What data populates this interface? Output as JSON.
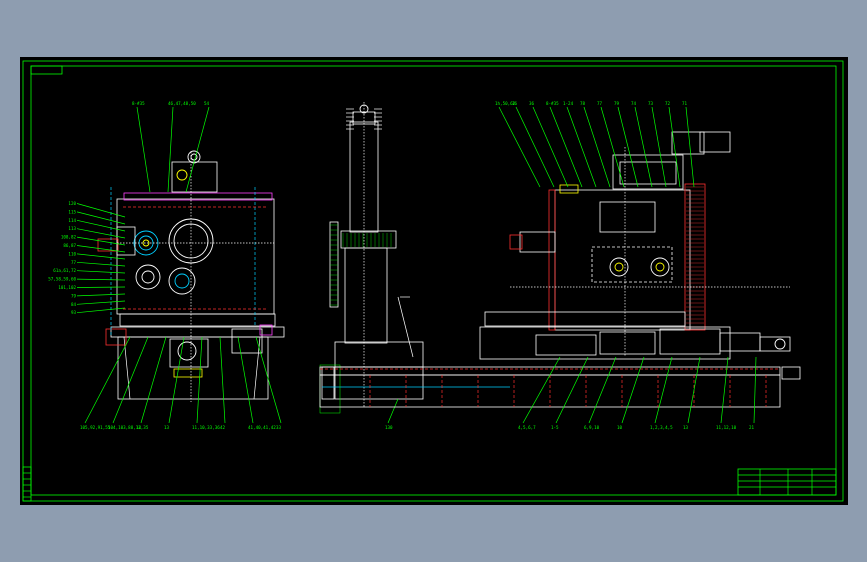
{
  "app": {
    "background": "#8e9db0",
    "viewport_background": "#000000"
  },
  "colors": {
    "frame": "#00ff00",
    "outline": "#ffffff",
    "leader": "#00ff00",
    "hidden": "#ff3030",
    "dim": "#00d0ff",
    "accent": "#ffff00",
    "magenta": "#ff40ff"
  },
  "drawing": {
    "left_view": {
      "top_labels": [
        "8-#35",
        "46,47,48,50",
        "54"
      ],
      "left_labels": [
        "120",
        "115",
        "114",
        "113",
        "108,82",
        "86,87",
        "110",
        "77",
        "61a,61,72",
        "57,58,59,60",
        "101,102",
        "79",
        "84",
        "93"
      ],
      "bottom_labels": [
        "105,92,91,55",
        "104,103,88,12,35",
        "14",
        "13",
        "11,10,33,36",
        "42",
        "41,40,41,42",
        "33"
      ]
    },
    "middle_view": {
      "bottom_labels": [
        "130"
      ]
    },
    "right_view": {
      "top_labels": [
        "1h,50,62",
        "16",
        "36",
        "8-#35",
        "1-24",
        "78",
        "77",
        "79",
        "74",
        "73",
        "72",
        "71"
      ],
      "bottom_labels": [
        "4,5,6,7",
        "1-5",
        "6,9,10",
        "10",
        "1,2,3,4,5",
        "13",
        "11,12,10",
        "21"
      ]
    },
    "title_block": {
      "fields": [
        "",
        "",
        "",
        ""
      ]
    }
  }
}
